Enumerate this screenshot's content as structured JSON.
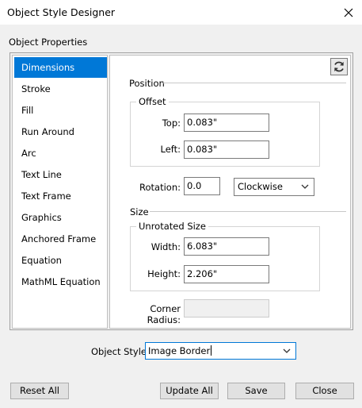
{
  "window": {
    "title": "Object Style Designer"
  },
  "group_label": "Object Properties",
  "categories": [
    {
      "label": "Dimensions",
      "selected": true
    },
    {
      "label": "Stroke",
      "selected": false
    },
    {
      "label": "Fill",
      "selected": false
    },
    {
      "label": "Run Around",
      "selected": false
    },
    {
      "label": "Arc",
      "selected": false
    },
    {
      "label": "Text Line",
      "selected": false
    },
    {
      "label": "Text Frame",
      "selected": false
    },
    {
      "label": "Graphics",
      "selected": false
    },
    {
      "label": "Anchored Frame",
      "selected": false
    },
    {
      "label": "Equation",
      "selected": false
    },
    {
      "label": "MathML Equation",
      "selected": false
    }
  ],
  "position": {
    "heading": "Position",
    "offset_caption": "Offset",
    "top_label": "Top:",
    "top_value": "0.083\"",
    "left_label": "Left:",
    "left_value": "0.083\"",
    "rotation_label": "Rotation:",
    "rotation_value": "0.0",
    "rotation_direction": "Clockwise"
  },
  "size": {
    "heading": "Size",
    "unrotated_caption": "Unrotated Size",
    "width_label": "Width:",
    "width_value": "6.083\"",
    "height_label": "Height:",
    "height_value": "2.206\"",
    "corner_radius_label": "Corner Radius:",
    "corner_radius_value": ""
  },
  "object_style": {
    "label": "Object Style:",
    "value": "Image Border"
  },
  "buttons": {
    "reset_all": "Reset All",
    "update_all": "Update All",
    "save": "Save",
    "close": "Close"
  },
  "icons": {
    "close": "close-icon",
    "refresh": "refresh-icon",
    "dropdown": "chevron-down-icon"
  },
  "colors": {
    "selection": "#0078d7",
    "focus_border": "#0078d7"
  }
}
